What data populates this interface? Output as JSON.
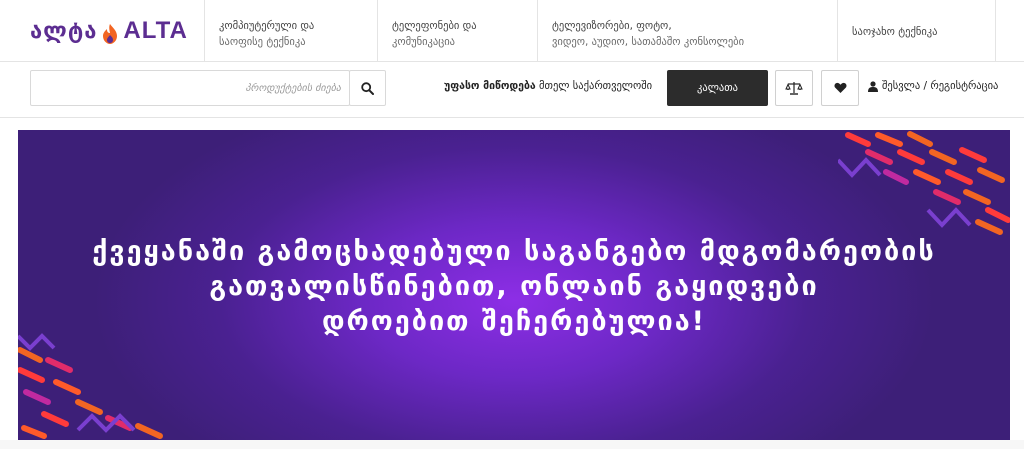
{
  "header": {
    "logo_geo": "ალტა",
    "logo_latin": "ALTA",
    "nav": [
      {
        "line1": "კომპიუტერული და",
        "line2": "საოფისე ტექნიკა"
      },
      {
        "line1": "ტელეფონები და",
        "line2": "კომუნიკაცია"
      },
      {
        "line1": "ტელევიზორები, ფოტო,",
        "line2": "ვიდეო, აუდიო, სათამაშო კონსოლები"
      },
      {
        "line1": "საოჯახო ტექნიკა",
        "line2": ""
      }
    ]
  },
  "toolbar": {
    "search_placeholder": "პროდუქტების ძიება",
    "free_shipping_bold": "უფასო მიწოდება",
    "free_shipping_rest": " მთელ საქართველოში",
    "cart_label": "კალათა",
    "login_label": "შესვლა / რეგისტრაცია"
  },
  "banner": {
    "lines": [
      "ქვეყანაში გამოცხადებული საგანგებო მდგომარეობის",
      "გათვალისწინებით, ონლაინ გაყიდვები",
      "დროებით შეჩერებულია!"
    ]
  },
  "colors": {
    "brand": "#5c2d91",
    "accent_orange": "#f26522",
    "banner_center": "#8d2ee6",
    "banner_edge": "#3d1f78",
    "cart_bg": "#2c2c2c"
  },
  "icons": {
    "search": "search-icon",
    "compare": "scale-icon",
    "wishlist": "heart-icon",
    "user": "user-icon"
  }
}
